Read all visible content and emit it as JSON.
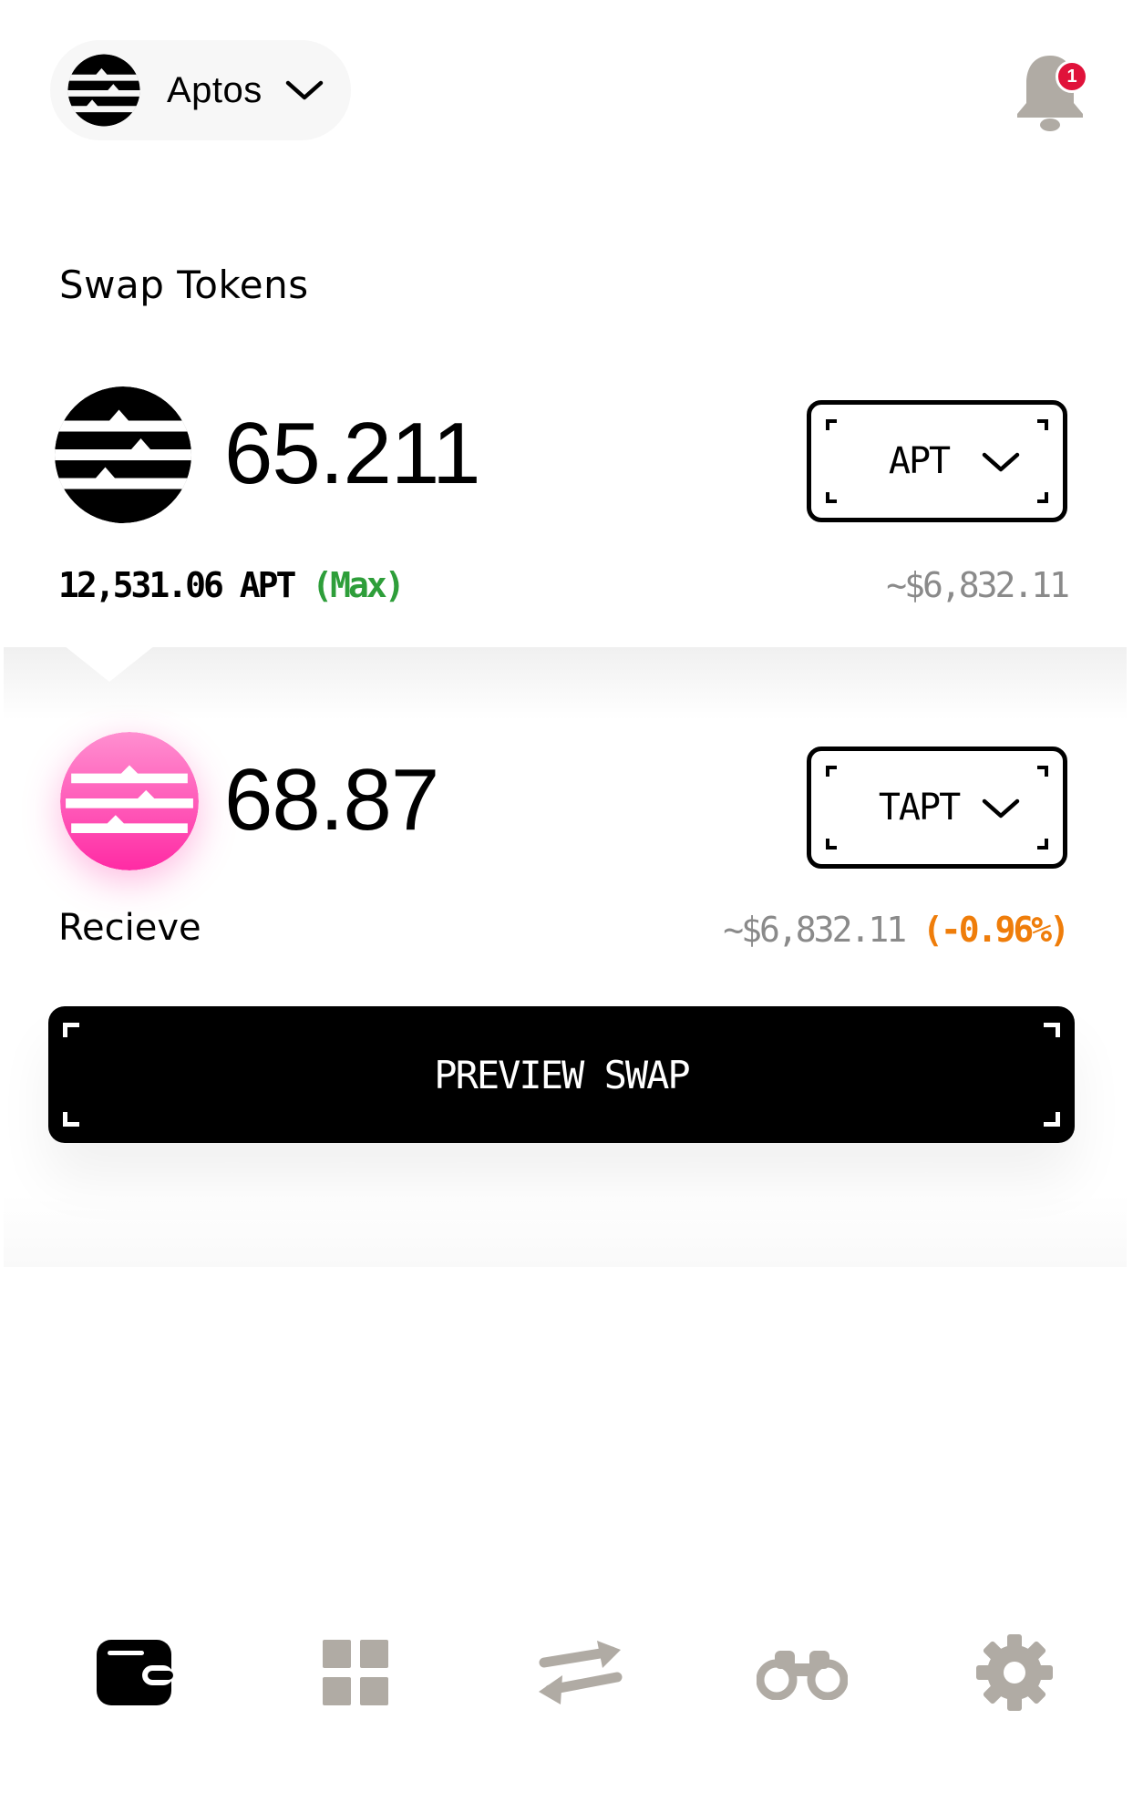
{
  "header": {
    "network_label": "Aptos",
    "network_icon": "aptos-logo-icon",
    "notification_count": "1"
  },
  "swap": {
    "title": "Swap Tokens",
    "from": {
      "amount": "65.211",
      "token": "APT",
      "balance_text": "12,531.06 APT ",
      "max_label": "(Max)",
      "usd_value": "~$6,832.11"
    },
    "to": {
      "amount": "68.87",
      "token": "TAPT",
      "label": "Recieve",
      "usd_value": "~$6,832.11 ",
      "change": "(-0.96%)"
    },
    "preview_button": "PREVIEW SWAP"
  },
  "nav": {
    "items": [
      {
        "icon": "wallet-icon",
        "active": true
      },
      {
        "icon": "grid-icon",
        "active": false
      },
      {
        "icon": "swap-arrows-icon",
        "active": false
      },
      {
        "icon": "binoculars-icon",
        "active": false
      },
      {
        "icon": "gear-icon",
        "active": false
      }
    ]
  },
  "colors": {
    "accent_green": "#2e9e3a",
    "accent_orange": "#ef7d0a",
    "badge_red": "#e0123a",
    "icon_gray": "#b0aba4",
    "receive_token_pink": "#ff3fae"
  }
}
